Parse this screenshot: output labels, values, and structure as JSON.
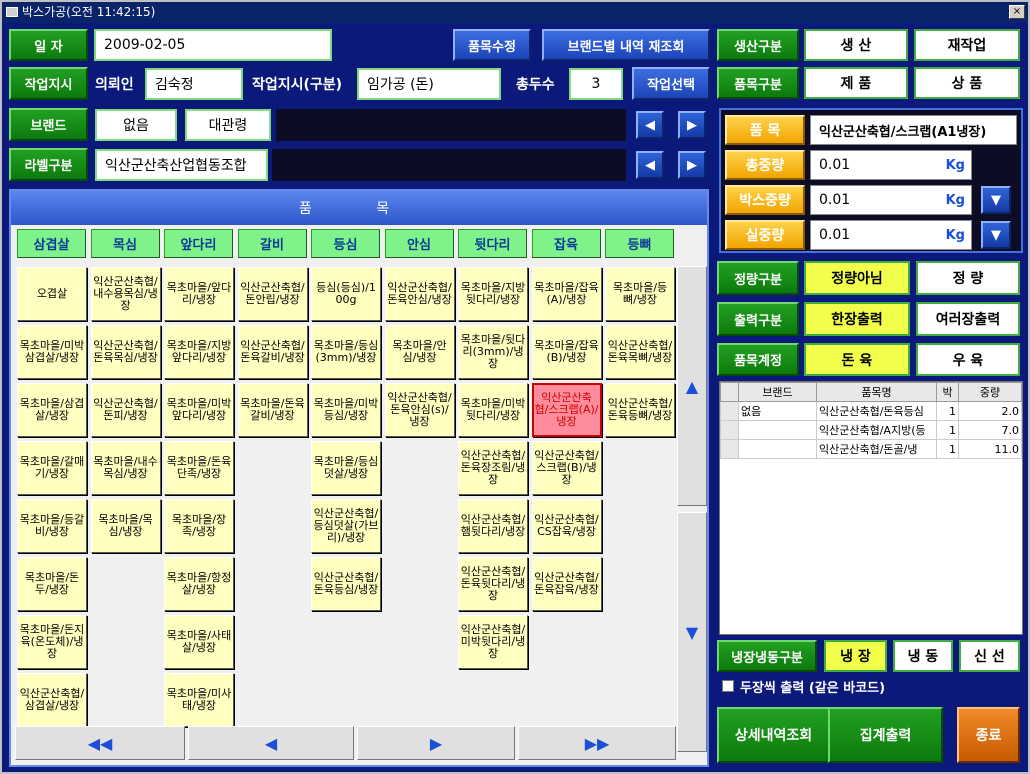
{
  "window": {
    "title": "박스가공(오전 11:42:15)",
    "close": "×"
  },
  "top": {
    "date_label": "일 자",
    "date_value": "2009-02-05",
    "item_edit": "품목수정",
    "brand_requery": "브랜드별 내역 재조회",
    "work_order_label": "작업지시",
    "requester_label": "의뢰인",
    "requester_value": "김숙정",
    "work_order_type_label": "작업지시(구분)",
    "work_order_type_value": "임가공 (돈)",
    "total_label": "총두수",
    "total_value": "3",
    "work_select": "작업선택",
    "brand_label": "브랜드",
    "brand_value1": "없음",
    "brand_value2": "대관령",
    "label_type_label": "라벨구분",
    "label_type_value": "익산군산축산업협동조합"
  },
  "right_top": {
    "production_label": "생산구분",
    "production_opts": [
      "생 산",
      "재작업"
    ],
    "item_type_label": "품목구분",
    "item_type_opts": [
      "제 품",
      "상 품"
    ]
  },
  "item_panel": {
    "item_label": "품 목",
    "item_value": "익산군산축협/스크랩(A1냉장)",
    "total_weight_label": "총중량",
    "total_weight_value": "0.01",
    "box_weight_label": "박스중량",
    "box_weight_value": "0.01",
    "net_weight_label": "실중량",
    "net_weight_value": "0.01",
    "unit": "Kg"
  },
  "options": {
    "fixed_label": "정량구분",
    "fixed_opts": [
      "정량아님",
      "정 량"
    ],
    "print_label": "출력구분",
    "print_opts": [
      "한장출력",
      "여러장출력"
    ],
    "account_label": "품목계정",
    "account_opts": [
      "돈 육",
      "우 육"
    ]
  },
  "list": {
    "headers": [
      "브랜드",
      "품목명",
      "박",
      "중량"
    ],
    "rows": [
      {
        "brand": "없음",
        "name": "익산군산축협/돈육등심",
        "box": "1",
        "weight": "2.0"
      },
      {
        "brand": "",
        "name": "익산군산축협/A지방(등",
        "box": "1",
        "weight": "7.0"
      },
      {
        "brand": "",
        "name": "익산군산축협/돈골/냉",
        "box": "1",
        "weight": "11.0"
      }
    ]
  },
  "storage": {
    "label": "냉장냉동구분",
    "opts": [
      "냉 장",
      "냉 동",
      "신 선"
    ],
    "two_copies": "두장씩 출력 (같은 바코드)"
  },
  "bottom": {
    "detail": "상세내역조회",
    "summary": "집계출력",
    "exit": "종료"
  },
  "grid": {
    "title": "품    목",
    "categories": [
      "삼겹살",
      "목심",
      "앞다리",
      "갈비",
      "등심",
      "안심",
      "뒷다리",
      "잡육",
      "등뼈"
    ],
    "columns": [
      [
        "오겹살",
        "목초마을/미박삼겹살/냉장",
        "목초마을/삼겹살/냉장",
        "목초마을/갈매기/냉장",
        "목초마을/등갈비/냉장",
        "목초마을/돈두/냉장",
        "목초마을/돈지육(온도체)/냉장",
        "익산군산축협/삼겹살/냉장"
      ],
      [
        "익산군산축협/내수용목심/냉장",
        "익산군산축협/돈육목심/냉장",
        "익산군산축협/돈피/냉장",
        "목초마을/내수목심/냉장",
        "목초마을/목심/냉장"
      ],
      [
        "목초마을/앞다리/냉장",
        "목초마을/지방앞다리/냉장",
        "목초마을/미박앞다리/냉장",
        "목초마을/돈육단족/냉장",
        "목초마을/장족/냉장",
        "목초마을/항정살/냉장",
        "목초마을/사태살/냉장",
        "목초마을/미사태/냉장"
      ],
      [
        "익산군산축협/돈안립/냉장",
        "익산군산축협/돈육갈비/냉장",
        "목초마을/돈육갈비/냉장"
      ],
      [
        "등심(등심)/100g",
        "목초마을/등심(3mm)/냉장",
        "목초마을/미박등심/냉장",
        "목초마을/등심덧살/냉장",
        "익산군산축협/등심덧살(가브리)/냉장",
        "익산군산축협/돈육등심/냉장"
      ],
      [
        "익산군산축협/돈육안심/냉장",
        "목초마을/안심/냉장",
        "익산군산축협/돈육안심(s)/냉장"
      ],
      [
        "목초마을/지방뒷다리/냉장",
        "목초마을/뒷다리(3mm)/냉장",
        "목초마을/미박뒷다리/냉장",
        "익산군산축협/돈육장조림/냉장",
        "익산군산축협/햄뒷다리/냉장",
        "익산군산축협/돈육뒷다리/냉장",
        "익산군산축협/미박뒷다리/냉장"
      ],
      [
        "목초마을/잡육(A)/냉장",
        "목초마을/잡육(B)/냉장",
        "익산군산축협/스크랩(A)/냉장",
        "익산군산축협/스크랩(B)/냉장",
        "익산군산축협/CS잡육/냉장",
        "익산군산축협/돈육잡육/냉장"
      ],
      [
        "목초마을/등뼈/냉장",
        "익산군산축협/돈육목뼈/냉장",
        "익산군산축협/돈육등뼈/냉장"
      ]
    ],
    "selected": [
      7,
      2
    ],
    "nav": [
      "◀◀",
      "◀",
      "▶",
      "▶▶"
    ],
    "scroll": [
      "▲",
      "▼"
    ]
  }
}
